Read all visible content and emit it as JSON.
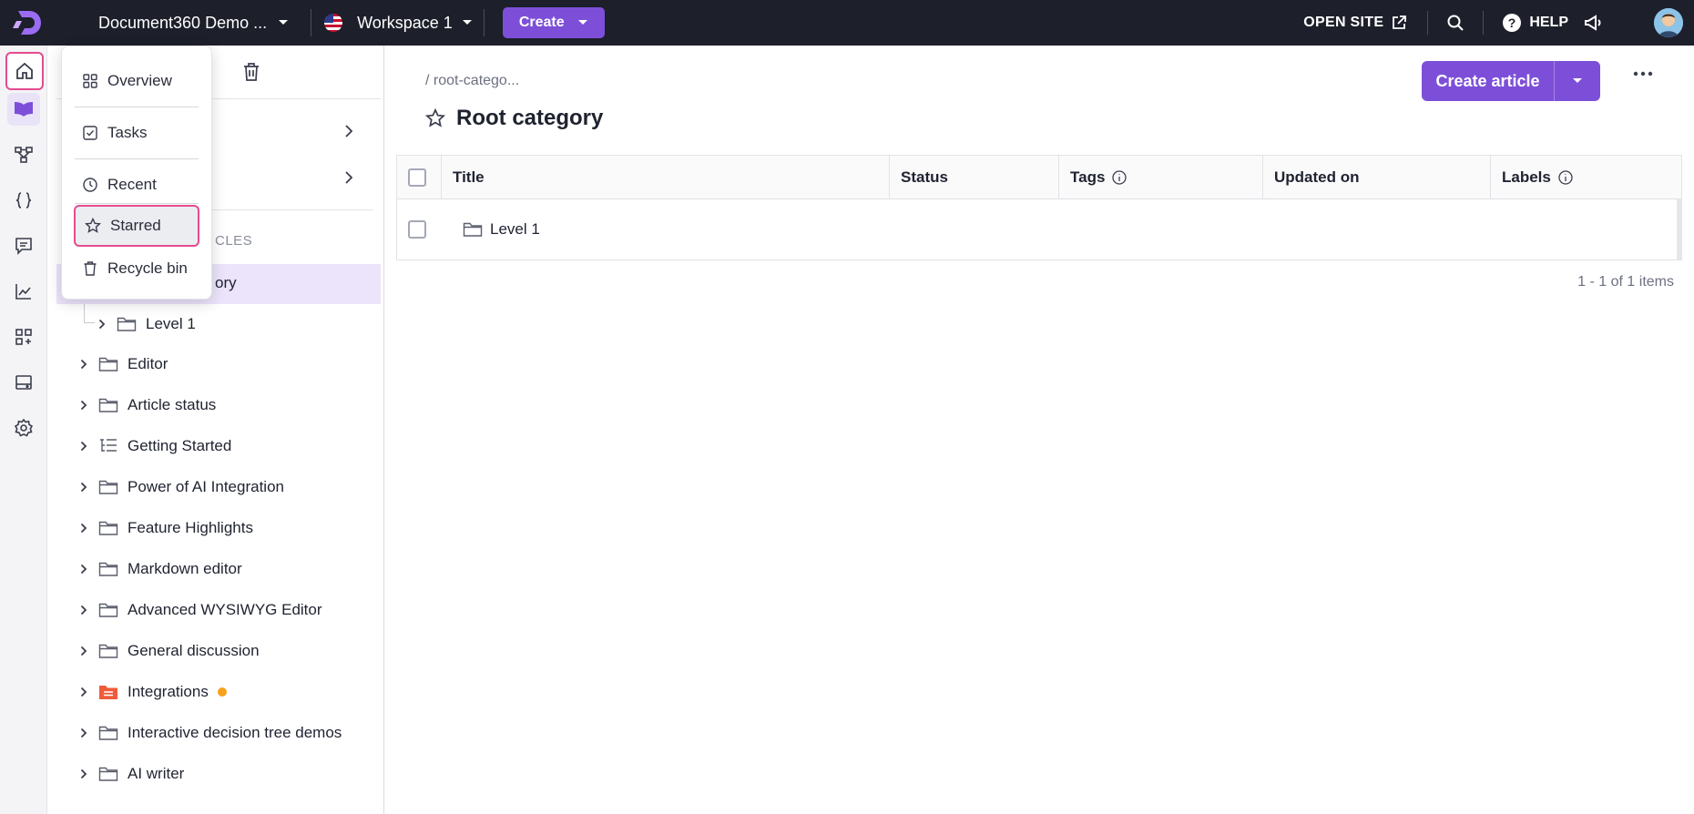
{
  "topbar": {
    "project_name": "Document360 Demo ...",
    "workspace": "Workspace 1",
    "create_label": "Create",
    "open_site_label": "OPEN SITE",
    "help_label": "HELP"
  },
  "rail": {
    "items": [
      "home-icon",
      "book-icon",
      "workflow-icon",
      "code-braces-icon",
      "feedback-icon",
      "analytics-icon",
      "apps-add-icon",
      "drive-icon",
      "settings-icon"
    ]
  },
  "menu": {
    "items": [
      {
        "label": "Overview",
        "icon": "grid-icon"
      },
      {
        "label": "Tasks",
        "icon": "checkbox-icon"
      },
      {
        "label": "Recent",
        "icon": "clock-icon"
      },
      {
        "label": "Starred",
        "icon": "star-icon"
      },
      {
        "label": "Recycle bin",
        "icon": "trash-icon"
      }
    ]
  },
  "sidebar": {
    "section_label": "CLES",
    "selected_partial": "ory",
    "tree": [
      {
        "label": "Level 1"
      },
      {
        "label": "Editor"
      },
      {
        "label": "Article status"
      },
      {
        "label": "Getting Started"
      },
      {
        "label": "Power of AI Integration"
      },
      {
        "label": "Feature Highlights"
      },
      {
        "label": "Markdown editor"
      },
      {
        "label": "Advanced WYSIWYG Editor"
      },
      {
        "label": "General discussion"
      },
      {
        "label": "Integrations"
      },
      {
        "label": "Interactive decision tree demos"
      },
      {
        "label": "AI writer"
      }
    ]
  },
  "main": {
    "breadcrumb": "/ root-catego...",
    "title": "Root category",
    "create_article_label": "Create article",
    "columns": [
      "Title",
      "Status",
      "Tags",
      "Updated on",
      "Labels"
    ],
    "rows": [
      {
        "title": "Level 1"
      }
    ],
    "pager": "1 - 1 of 1 items"
  },
  "colors": {
    "accent": "#7d4fd8",
    "highlight_border": "#e44c8f",
    "topbar": "#1d1f2b"
  }
}
